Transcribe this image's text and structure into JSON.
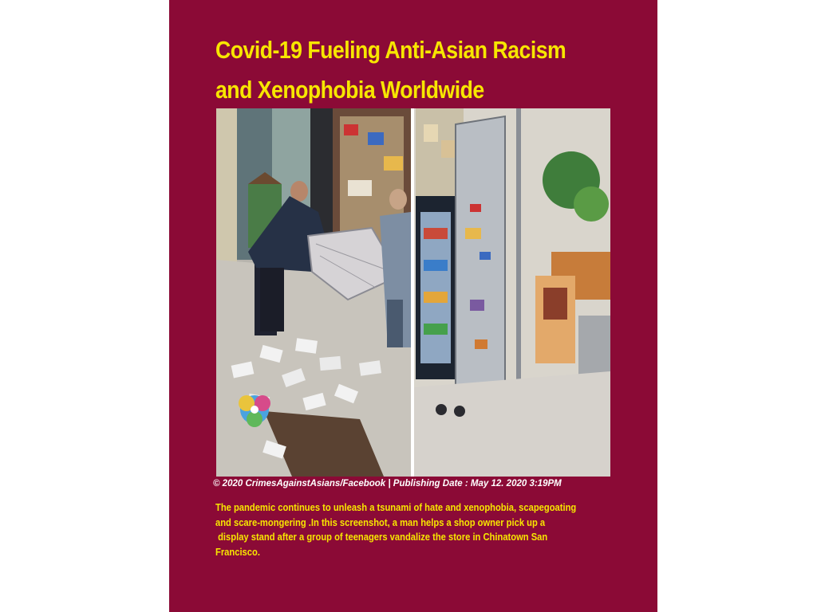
{
  "article": {
    "title_lines": [
      "Covid-19 Fueling Anti-Asian Racism",
      "and Xenophobia Worldwide"
    ],
    "photo": {
      "left_icon": "vandalized-sidewalk-display-photo",
      "right_icon": "shop-interior-display-stand-photo"
    },
    "credit": "© 2020 CrimesAgainstAsians/Facebook | Publishing Date : May 12. 2020 3:19PM",
    "body_lines": [
      "The pandemic continues to unleash a tsunami of hate and xenophobia, scapegoating",
      "and scare-mongering .In this screenshot, a man helps a shop owner pick up a",
      " display stand after a group of teenagers vandalize the store in Chinatown San",
      "Francisco."
    ]
  },
  "colors": {
    "page_background": "#8b0a36",
    "title_color": "#f7e600",
    "credit_color": "#ffffff"
  }
}
